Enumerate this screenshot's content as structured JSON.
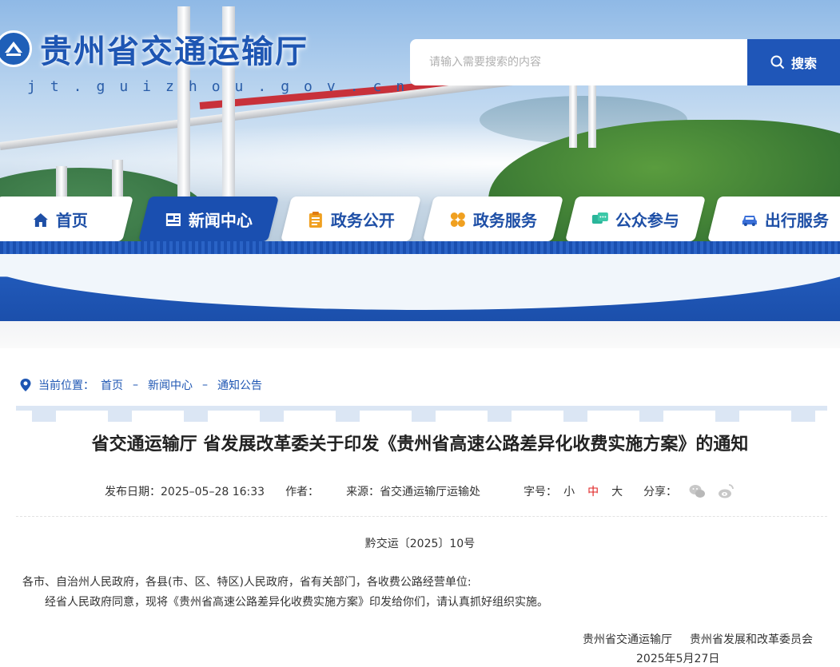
{
  "header": {
    "site_title": "贵州省交通运输厅",
    "domain": "jt.guizhou.gov.cn",
    "logo_icon": "provincial-emblem-icon"
  },
  "search": {
    "placeholder": "请输入需要搜索的内容",
    "button_label": "搜索",
    "icon": "search-icon"
  },
  "nav": {
    "items": [
      {
        "label": "首页",
        "icon": "home-icon",
        "active": false
      },
      {
        "label": "新闻中心",
        "icon": "newspaper-icon",
        "active": true
      },
      {
        "label": "政务公开",
        "icon": "clipboard-icon",
        "active": false
      },
      {
        "label": "政务服务",
        "icon": "grid-icon",
        "active": false
      },
      {
        "label": "公众参与",
        "icon": "chat-icon",
        "active": false
      },
      {
        "label": "出行服务",
        "icon": "car-icon",
        "active": false
      }
    ],
    "active_color": "#1a4fb0",
    "text_color": "#1e4fa6"
  },
  "breadcrumb": {
    "prefix": "当前位置：",
    "items": [
      "首页",
      "新闻中心",
      "通知公告"
    ],
    "separator": "–",
    "icon": "location-pin-icon"
  },
  "article": {
    "title": "省交通运输厅 省发展改革委关于印发《贵州省高速公路差异化收费实施方案》的通知",
    "meta": {
      "date_label": "发布日期：2025–05–28 16:33",
      "author_label": "作者：",
      "source_label": "来源：",
      "source_value": "省交通运输厅运输处",
      "font_size_label": "字号：",
      "font_sizes": [
        "小",
        "中",
        "大"
      ],
      "active_font_size": "中",
      "share_label": "分享：",
      "share_icons": [
        "wechat-icon",
        "weibo-icon"
      ]
    },
    "doc_number": "黔交运〔2025〕10号",
    "paragraphs": [
      "各市、自治州人民政府，各县(市、区、特区)人民政府，省有关部门，各收费公路经营单位:",
      "经省人民政府同意，现将《贵州省高速公路差异化收费实施方案》印发给你们，请认真抓好组织实施。"
    ],
    "signatories": [
      "贵州省交通运输厅",
      "贵州省发展和改革委员会"
    ],
    "sign_date": "2025年5月27日"
  },
  "colors": {
    "brand_blue": "#1e56b3",
    "highlight_red": "#e02020"
  }
}
